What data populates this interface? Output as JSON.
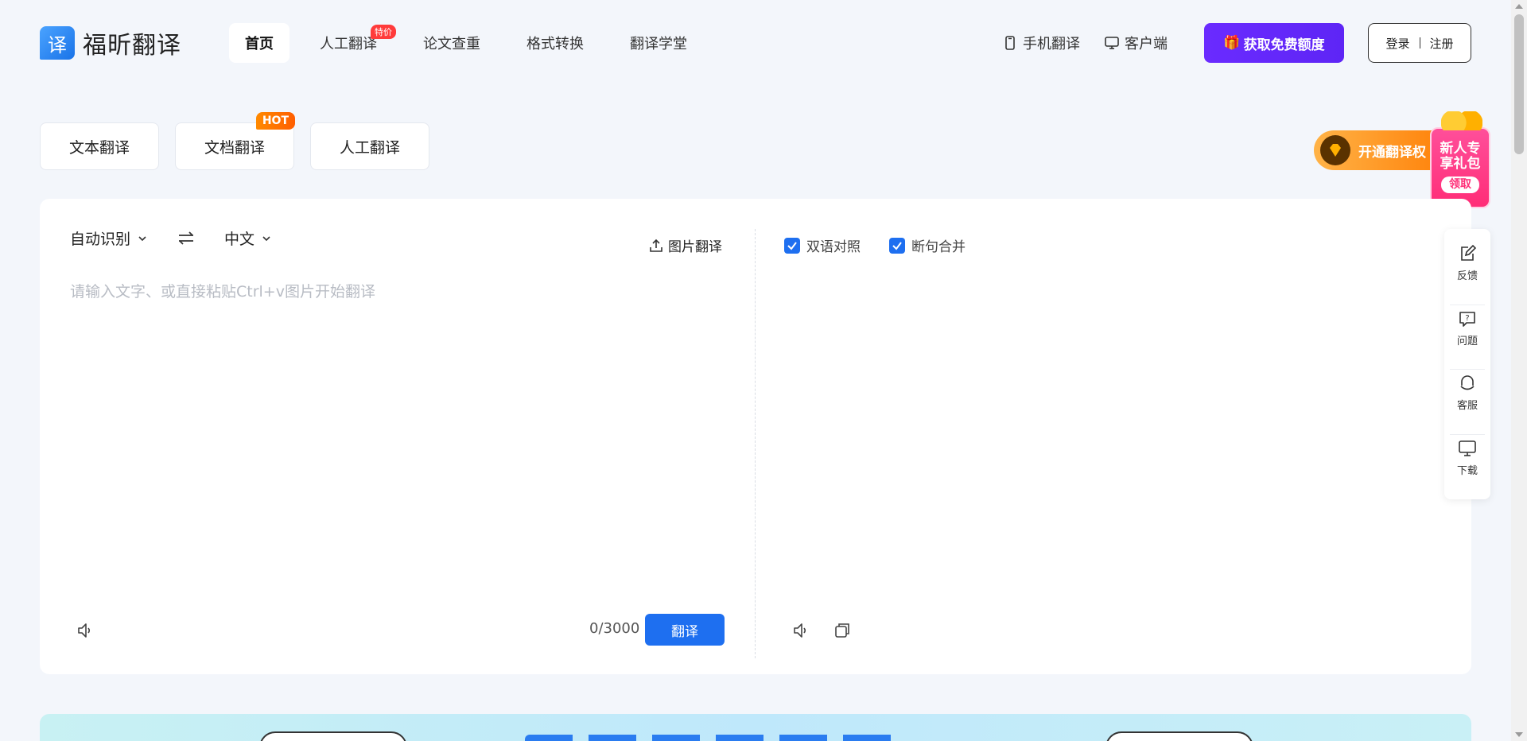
{
  "brand": {
    "logo_glyph": "译",
    "name": "福昕翻译"
  },
  "nav": [
    {
      "label": "首页",
      "active": true
    },
    {
      "label": "人工翻译",
      "badge": "特价"
    },
    {
      "label": "论文查重"
    },
    {
      "label": "格式转换"
    },
    {
      "label": "翻译学堂"
    }
  ],
  "header": {
    "mobile_label": "手机翻译",
    "client_label": "客户端",
    "free_quota_label": "获取免费额度",
    "login_label": "登录",
    "register_label": "注册"
  },
  "mode_tabs": [
    {
      "label": "文本翻译"
    },
    {
      "label": "文档翻译",
      "badge": "HOT"
    },
    {
      "label": "人工翻译"
    }
  ],
  "promo": {
    "strip_label": "开通翻译权",
    "gift_line1": "新人专",
    "gift_line2": "享礼包",
    "gift_claim": "领取"
  },
  "translator": {
    "source_lang": "自动识别",
    "target_lang": "中文",
    "image_translate_label": "图片翻译",
    "input_placeholder": "请输入文字、或直接粘贴Ctrl+v图片开始翻译",
    "char_count": "0/3000",
    "translate_button": "翻译",
    "options": [
      {
        "label": "双语对照",
        "checked": true
      },
      {
        "label": "断句合并",
        "checked": true
      }
    ]
  },
  "side_toolbar": [
    {
      "label": "反馈",
      "icon": "edit-icon"
    },
    {
      "label": "问题",
      "icon": "question-icon"
    },
    {
      "label": "客服",
      "icon": "headset-icon"
    },
    {
      "label": "下载",
      "icon": "monitor-icon"
    }
  ],
  "colors": {
    "accent": "#1e6ff0",
    "purple_cta": "#5e25f5",
    "hot_orange": "#ff6a00",
    "badge_red": "#ff3b3b",
    "page_bg": "#f3f6fb"
  }
}
